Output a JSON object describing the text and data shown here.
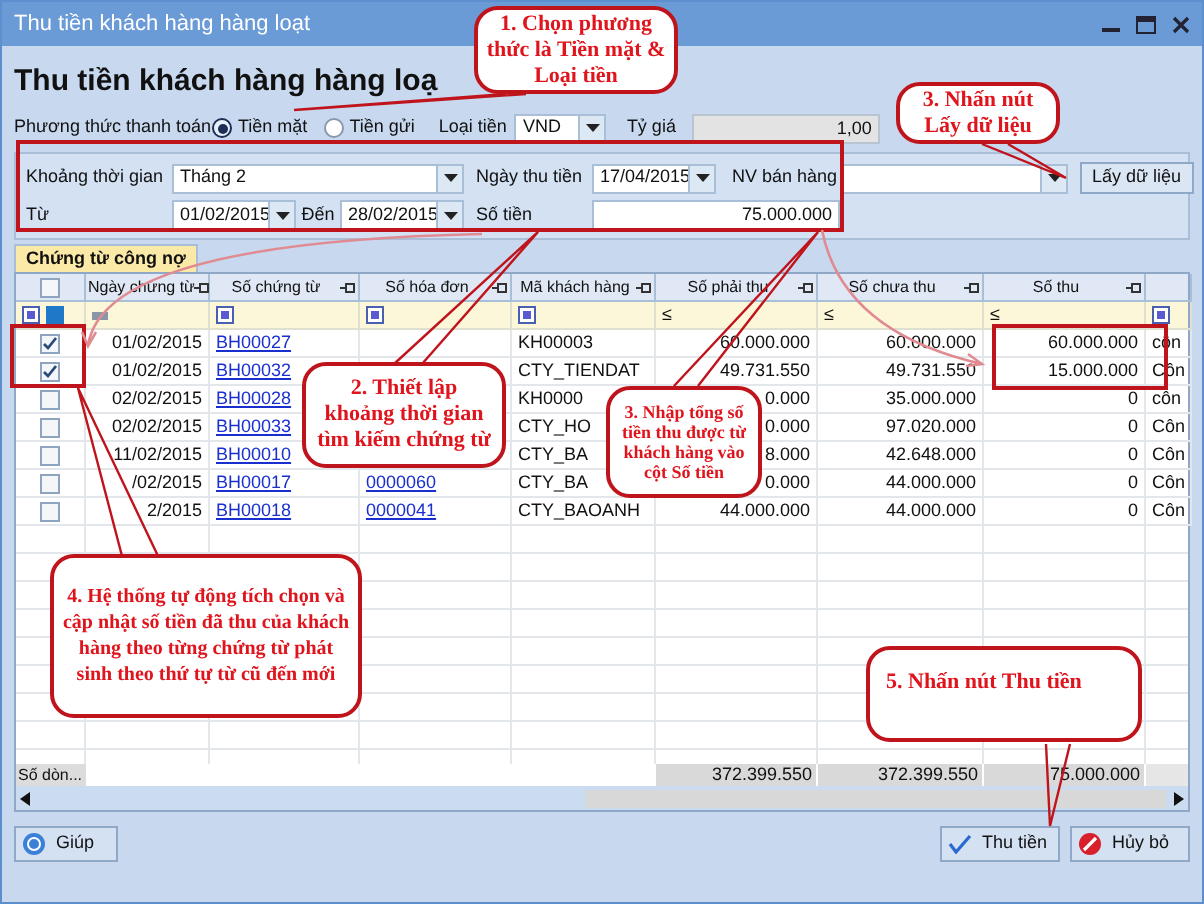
{
  "window": {
    "title": "Thu tiền khách hàng hàng loạt"
  },
  "heading": "Thu tiền khách hàng hàng loạ",
  "payment": {
    "label": "Phương thức thanh toán",
    "methods": [
      {
        "label": "Tiền mặt",
        "selected": true
      },
      {
        "label": "Tiền gửi",
        "selected": false
      }
    ],
    "currency_label": "Loại tiền",
    "currency": "VND",
    "rate_label": "Tỷ giá",
    "rate": "1,00"
  },
  "filters": {
    "period_label": "Khoảng thời gian",
    "period": "Tháng 2",
    "date_label": "Ngày thu tiền",
    "date": "17/04/2015",
    "staff_label": "NV bán hàng",
    "fetch_button": "Lấy dữ liệu",
    "from_label": "Từ",
    "from": "01/02/2015",
    "to_label": "Đến",
    "to": "28/02/2015",
    "amount_label": "Số tiền",
    "amount": "75.000.000"
  },
  "tabs": [
    {
      "label": "Chứng từ công nợ",
      "selected": true
    }
  ],
  "table": {
    "all_checked": false,
    "columns": [
      {
        "kind": "check"
      },
      {
        "kind": "text",
        "label": "Ngày chứng từ"
      },
      {
        "kind": "text",
        "label": "Số chứng từ"
      },
      {
        "kind": "text",
        "label": "Số hóa đơn"
      },
      {
        "kind": "text",
        "label": "Mã khách hàng"
      },
      {
        "kind": "number",
        "label": "Số phải thu",
        "filter_op": "≤"
      },
      {
        "kind": "number",
        "label": "Số chưa thu",
        "filter_op": "≤"
      },
      {
        "kind": "number",
        "label": "Số thu",
        "filter_op": "≤"
      },
      {
        "kind": "text"
      }
    ],
    "rows": [
      {
        "checked": true,
        "date": "01/02/2015",
        "voucher": "BH00027",
        "customer": "KH00003",
        "receivable": "60.000.000",
        "outstanding": "60.000.000",
        "received": "60.000.000",
        "column_9": "côn"
      },
      {
        "checked": true,
        "date": "01/02/2015",
        "voucher": "BH00032",
        "customer": "CTY_TIENDAT",
        "receivable": "49.731.550",
        "outstanding": "49.731.550",
        "received": "15.000.000",
        "column_9": "Côn"
      },
      {
        "checked": false,
        "date": "02/02/2015",
        "voucher": "BH00028",
        "customer": "KH0000",
        "receivable": "0.000",
        "outstanding": "35.000.000",
        "received": "0",
        "column_9": "côn"
      },
      {
        "checked": false,
        "date": "02/02/2015",
        "voucher": "BH00033",
        "customer": "CTY_HO",
        "receivable": "0.000",
        "outstanding": "97.020.000",
        "received": "0",
        "column_9": "Côn"
      },
      {
        "checked": false,
        "date": "11/02/2015",
        "voucher": "BH00010",
        "customer": "CTY_BA",
        "receivable": "8.000",
        "outstanding": "42.648.000",
        "received": "0",
        "column_9": "Côn"
      },
      {
        "checked": false,
        "date": "/02/2015",
        "voucher": "BH00017",
        "invoice": "0000060",
        "customer": "CTY_BA",
        "receivable": "0.000",
        "outstanding": "44.000.000",
        "received": "0",
        "column_9": "Côn"
      },
      {
        "checked": false,
        "date": "2/2015",
        "voucher": "BH00018",
        "invoice": "0000041",
        "customer": "CTY_BAOANH",
        "receivable": "44.000.000",
        "outstanding": "44.000.000",
        "received": "0",
        "column_9": "Côn"
      }
    ],
    "footer": {
      "label": "Số dòn...",
      "receivable": "372.399.550",
      "outstanding": "372.399.550",
      "received": "75.000.000"
    }
  },
  "buttons": [
    {
      "kind": "help",
      "label": "Giúp"
    },
    {
      "kind": "confirm",
      "label": "Thu tiền"
    },
    {
      "kind": "cancel",
      "label": "Hủy bỏ"
    }
  ],
  "annotations": [
    {
      "text": "1. Chọn phương thức là Tiền mặt & Loại tiền"
    },
    {
      "text": "3. Nhấn nút Lấy dữ liệu"
    },
    {
      "text": "2. Thiết lập khoảng thời gian tìm kiếm chứng từ"
    },
    {
      "text": "3. Nhập tổng số tiền thu được từ khách hàng vào cột Số tiền"
    },
    {
      "text": "4. Hệ thống tự động tích chọn và cập nhật số tiền đã thu của khách hàng theo từng chứng từ phát sinh theo thứ tự từ cũ đến mới"
    },
    {
      "text": "5. Nhấn nút Thu tiền"
    }
  ]
}
